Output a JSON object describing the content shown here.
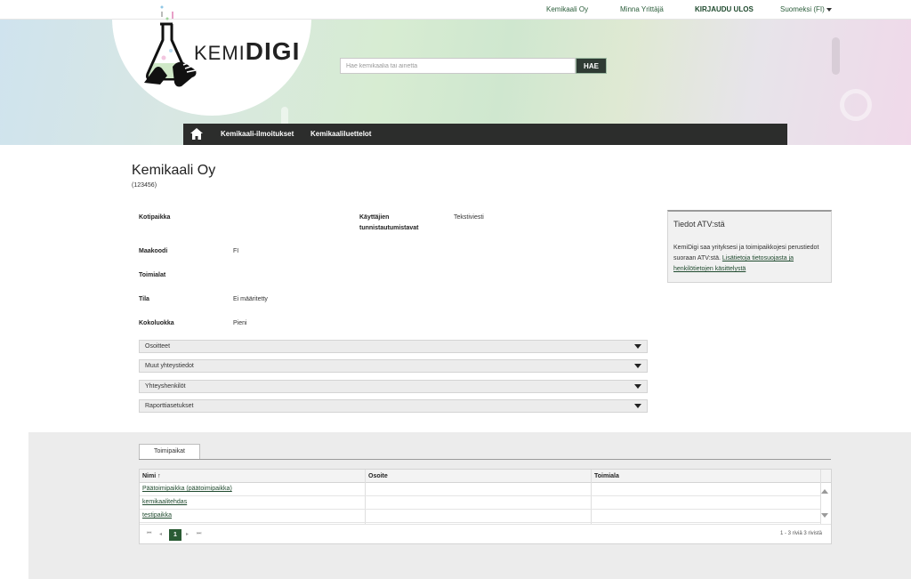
{
  "topbar": {
    "company": "Kemikaali Oy",
    "user": "Minna Yrittäjä",
    "logout": "KIRJAUDU ULOS",
    "language": "Suomeksi (FI)"
  },
  "logo": {
    "text_light": "KEMI",
    "text_bold": "DIGI"
  },
  "search": {
    "placeholder": "Hae kemikaalia tai ainetta",
    "button": "HAE"
  },
  "nav": {
    "items": [
      "Kemikaali-ilmoitukset",
      "Kemikaaliluettelot"
    ]
  },
  "company": {
    "name": "Kemikaali Oy",
    "id": "(123456)"
  },
  "fields": {
    "kotipaikka": {
      "label": "Kotipaikka",
      "value": ""
    },
    "maakoodi": {
      "label": "Maakoodi",
      "value": "FI"
    },
    "toimialat": {
      "label": "Toimialat",
      "value": ""
    },
    "tila": {
      "label": "Tila",
      "value": "Ei määritetty"
    },
    "kokoluokka": {
      "label": "Kokoluokka",
      "value": "Pieni"
    },
    "tunnistautuminen": {
      "label_line1": "Käyttäjien",
      "label_line2": "tunnistautumistavat",
      "value": "Tekstiviesti"
    }
  },
  "accordions": [
    "Osoitteet",
    "Muut yhteystiedot",
    "Yhteyshenkilöt",
    "Raporttiasetukset"
  ],
  "info_box": {
    "title": "Tiedot ATV:stä",
    "text": "KemiDigi saa yrityksesi ja toimipaikkojesi perustiedot suoraan ATV:stä. ",
    "link": "Lisätietoja tietosuojasta ja henkilötietojen käsittelystä"
  },
  "tabs": {
    "active": "Toimipaikat"
  },
  "table": {
    "columns": [
      "Nimi ↑",
      "Osoite",
      "Toimiala"
    ],
    "rows": [
      {
        "nimi": "Päätoimipaikka (päätoimipaikka)",
        "osoite": "",
        "toimiala": ""
      },
      {
        "nimi": "kemikaalitehdas",
        "osoite": "",
        "toimiala": ""
      },
      {
        "nimi": "testipaikka",
        "osoite": "",
        "toimiala": ""
      }
    ],
    "pager": {
      "first": "⏮",
      "prev": "◂",
      "current": "1",
      "next": "▸",
      "last": "⏭",
      "info": "1 - 3 riviä 3 rivistä"
    }
  },
  "colors": {
    "brand_dark": "#2c2d2c",
    "accent_green": "#2a5b34",
    "link": "#1f4a2e"
  },
  "icons": {
    "home": "home-icon",
    "flask": "flask-logo-icon"
  }
}
